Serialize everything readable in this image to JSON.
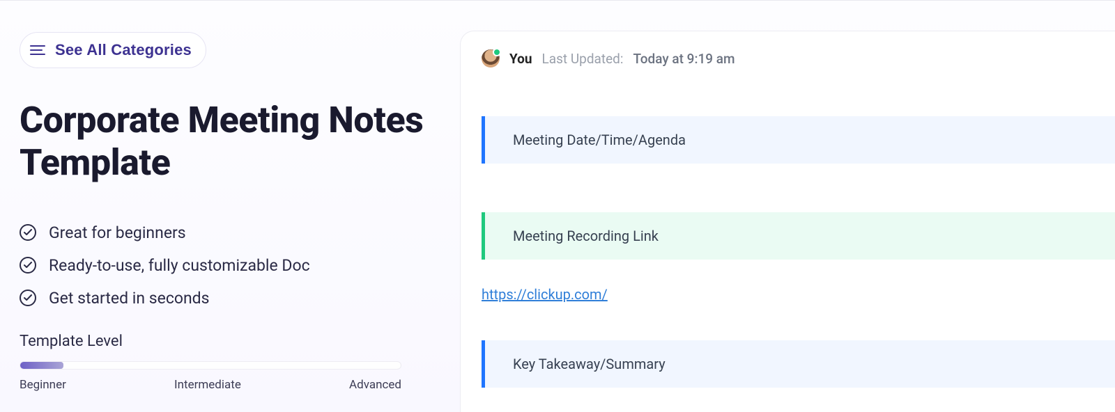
{
  "header": {
    "categories_label": "See All Categories"
  },
  "page": {
    "title": "Corporate Meeting Notes Template",
    "features": [
      "Great for beginners",
      "Ready-to-use, fully customizable Doc",
      "Get started in seconds"
    ],
    "level": {
      "label": "Template Level",
      "ticks": [
        "Beginner",
        "Intermediate",
        "Advanced"
      ],
      "value_index": 0
    }
  },
  "preview": {
    "author": "You",
    "updated_prefix": "Last Updated:",
    "updated_time": "Today at 9:19 am",
    "sections": {
      "meeting_info": "Meeting Date/Time/Agenda",
      "recording": "Meeting Recording Link",
      "recording_link": "https://clickup.com/",
      "takeaway": "Key Takeaway/Summary"
    },
    "colors": {
      "info_accent": "#1f75ff",
      "recording_accent": "#1fc97e"
    }
  }
}
